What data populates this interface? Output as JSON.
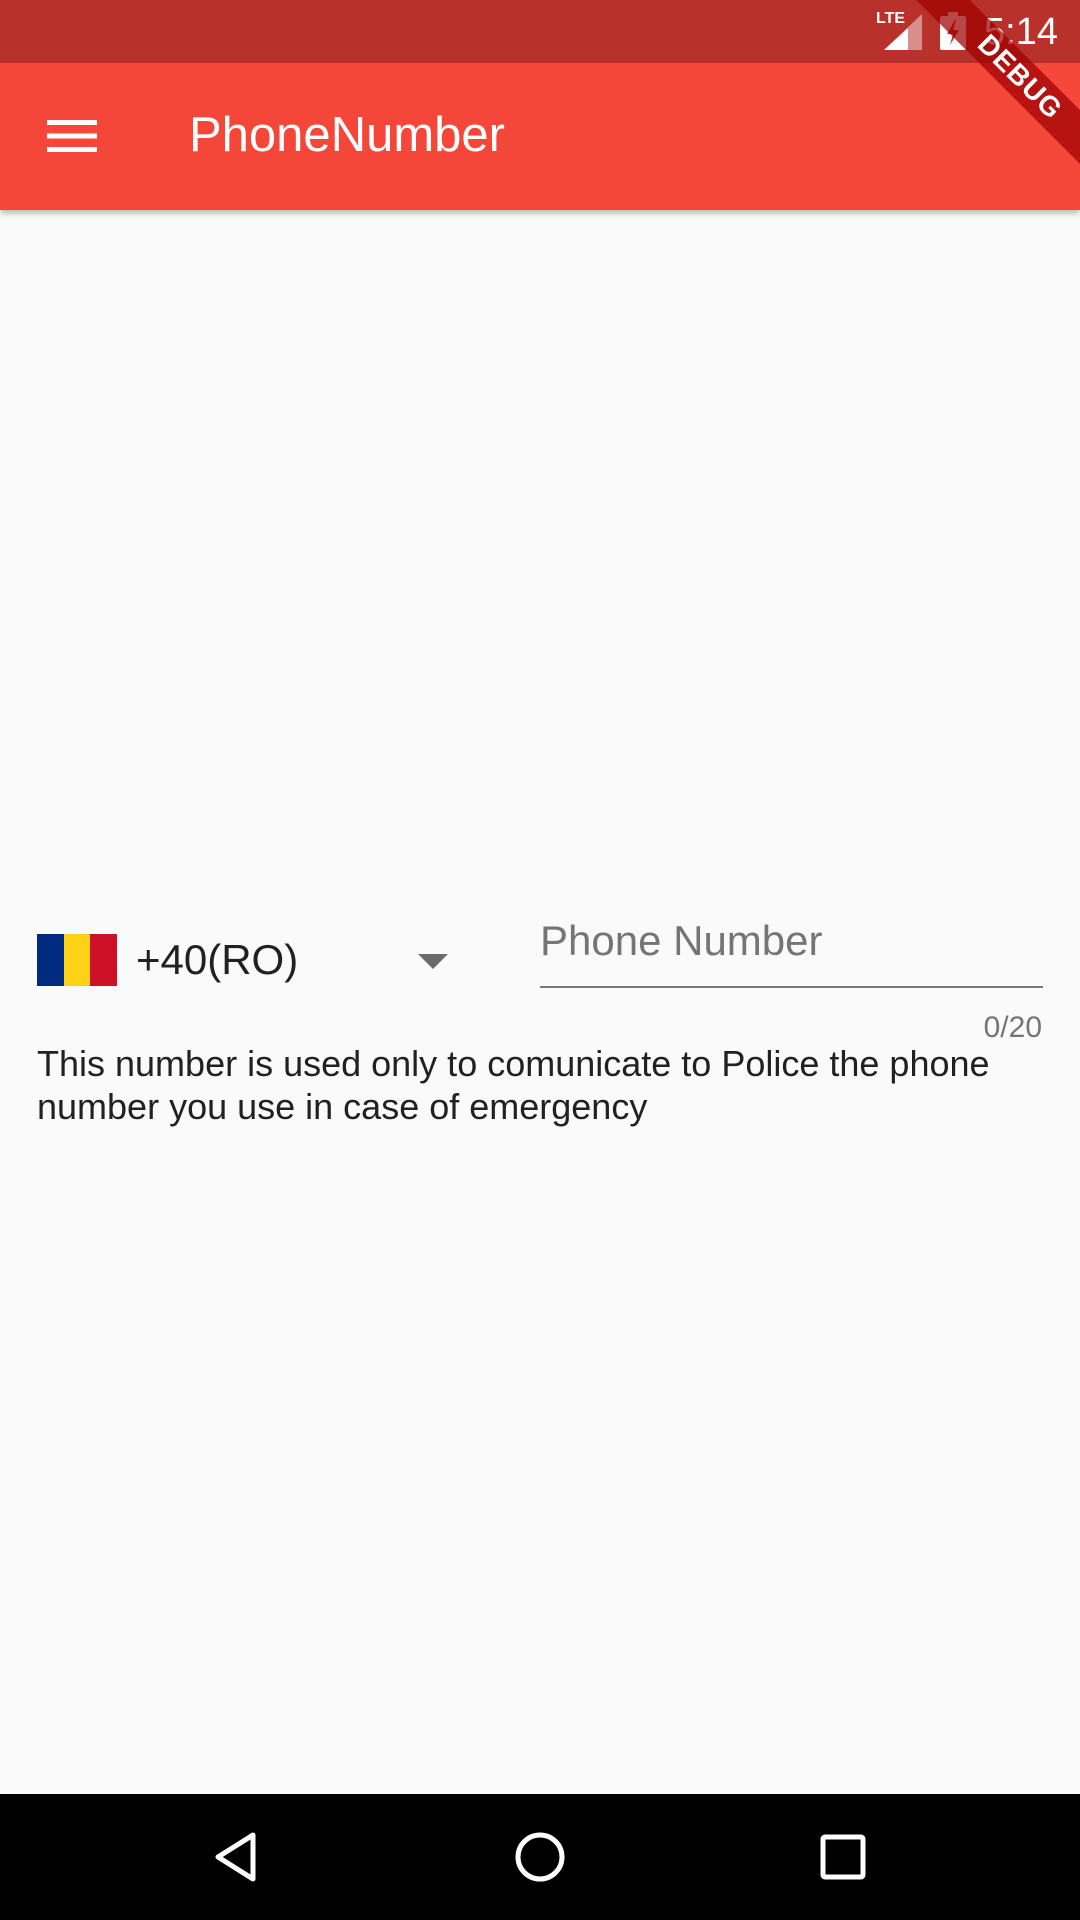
{
  "status_bar": {
    "network": "LTE",
    "time": "5:14"
  },
  "app_bar": {
    "title": "PhoneNumber",
    "menu_icon": "menu-icon",
    "debug_banner": "DEBUG"
  },
  "form": {
    "country": {
      "flag": "flag-romania-icon",
      "flag_colors": [
        "#002b7f",
        "#fcd116",
        "#ce1126"
      ],
      "code_label": "+40(RO)"
    },
    "phone": {
      "value": "",
      "placeholder": "Phone Number",
      "counter": "0/20"
    },
    "info": "This number is used only to comunicate to Police the phone number you use in case of emergency"
  },
  "colors": {
    "status_bar": "#b8322b",
    "app_bar": "#f44639",
    "background": "#fafafa",
    "nav_bar": "#000000"
  },
  "nav_bar": {
    "buttons": [
      "back-icon",
      "home-icon",
      "recents-icon"
    ]
  }
}
